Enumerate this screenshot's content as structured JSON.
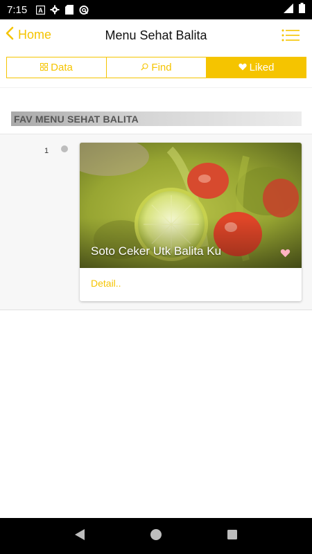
{
  "status_bar": {
    "time": "7:15",
    "icons": [
      "a-box-icon",
      "settings-icon",
      "sd-card-icon",
      "sync-icon"
    ],
    "right_icons": [
      "signal-icon",
      "battery-icon"
    ]
  },
  "header": {
    "back_label": "Home",
    "title": "Menu Sehat Balita"
  },
  "tabs": [
    {
      "label": "Data",
      "icon": "grid-icon",
      "active": false
    },
    {
      "label": "Find",
      "icon": "search-icon",
      "active": false
    },
    {
      "label": "Liked",
      "icon": "heart-icon",
      "active": true
    }
  ],
  "section": {
    "title": "FAV MENU SEHAT BALITA"
  },
  "items": [
    {
      "index": "1",
      "title": "Soto Ceker Utk Balita Ku",
      "detail_label": "Detail.."
    }
  ],
  "colors": {
    "accent": "#f5c400",
    "liked_heart": "#ffb3c1"
  }
}
